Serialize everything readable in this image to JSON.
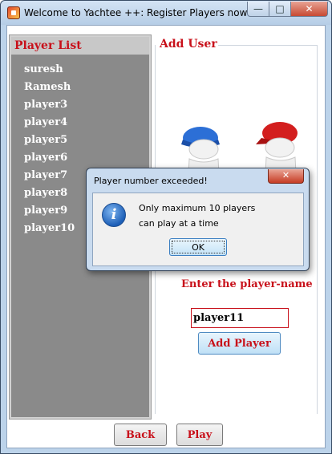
{
  "window": {
    "title": "Welcome to Yachtee ++: Register Players now!",
    "minimize_glyph": "—",
    "maximize_glyph": "□",
    "close_glyph": "✕"
  },
  "player_list": {
    "title": "Player List",
    "players": [
      "suresh",
      "Ramesh",
      "player3",
      "player4",
      "player5",
      "player6",
      "player7",
      "player8",
      "player9",
      "player10"
    ]
  },
  "add_user": {
    "title": "Add User",
    "illustration": "two-figures-playing-dice",
    "enter_label": "Enter the player-name",
    "name_value": "player11",
    "add_button": "Add Player"
  },
  "footer": {
    "back_button": "Back",
    "play_button": "Play"
  },
  "dialog": {
    "title": "Player number exceeded!",
    "close_glyph": "✕",
    "icon": "info-icon",
    "icon_glyph": "i",
    "message_line1": "Only maximum 10 players",
    "message_line2": "can play at a time",
    "ok_button": "OK"
  },
  "colors": {
    "accent_red": "#c8101a",
    "list_bg": "#8a8a8a",
    "frame": "#bcd3ea"
  }
}
